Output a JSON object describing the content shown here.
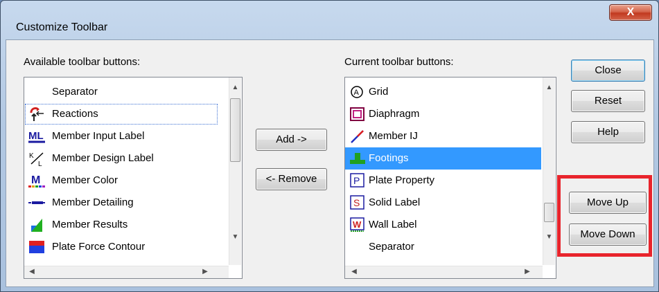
{
  "window": {
    "title": "Customize Toolbar",
    "close_glyph": "X"
  },
  "available": {
    "label": "Available toolbar buttons:",
    "items": [
      {
        "label": "Separator",
        "icon": "separator-icon"
      },
      {
        "label": "Reactions",
        "icon": "reactions-icon"
      },
      {
        "label": "Member Input Label",
        "icon": "member-input-label-icon",
        "glyph": "ML"
      },
      {
        "label": "Member Design Label",
        "icon": "member-design-label-icon",
        "glyph": "K/L"
      },
      {
        "label": "Member Color",
        "icon": "member-color-icon",
        "glyph": "M"
      },
      {
        "label": "Member Detailing",
        "icon": "member-detailing-icon"
      },
      {
        "label": "Member Results",
        "icon": "member-results-icon"
      },
      {
        "label": "Plate Force Contour",
        "icon": "plate-force-contour-icon"
      }
    ]
  },
  "current": {
    "label": "Current toolbar buttons:",
    "items": [
      {
        "label": "Grid",
        "icon": "grid-icon",
        "glyph": "A"
      },
      {
        "label": "Diaphragm",
        "icon": "diaphragm-icon"
      },
      {
        "label": "Member IJ",
        "icon": "member-ij-icon"
      },
      {
        "label": "Footings",
        "icon": "footings-icon",
        "selected": true
      },
      {
        "label": "Plate Property",
        "icon": "plate-property-icon",
        "glyph": "P"
      },
      {
        "label": "Solid Label",
        "icon": "solid-label-icon",
        "glyph": "S"
      },
      {
        "label": "Wall Label",
        "icon": "wall-label-icon",
        "glyph": "W"
      },
      {
        "label": "Separator",
        "icon": "separator-icon"
      }
    ]
  },
  "buttons": {
    "add": "Add ->",
    "remove": "<- Remove",
    "close": "Close",
    "reset": "Reset",
    "help": "Help",
    "move_up": "Move Up",
    "move_down": "Move Down"
  },
  "colors": {
    "selection": "#3399ff",
    "highlight_box": "#e8242c"
  }
}
